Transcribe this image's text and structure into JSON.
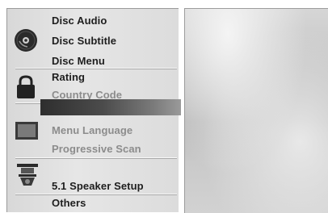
{
  "menu": {
    "items": [
      {
        "label": "Disc Audio",
        "state": "normal"
      },
      {
        "label": "Disc Subtitle",
        "state": "normal"
      },
      {
        "label": "Disc Menu",
        "state": "normal"
      },
      {
        "label": "Rating",
        "state": "normal"
      },
      {
        "label": "Country Code",
        "state": "dimmed"
      },
      {
        "label": "Menu Language",
        "state": "dimmed"
      },
      {
        "label": "Progressive Scan",
        "state": "dimmed"
      },
      {
        "label": "5.1 Speaker Setup",
        "state": "normal"
      },
      {
        "label": "Others",
        "state": "normal"
      }
    ],
    "icons": [
      "disc-icon",
      "padlock-icon",
      "tv-screen-icon",
      "speaker-icon"
    ]
  },
  "colors": {
    "background": "#ffffff",
    "panel": "#e0e0e0",
    "text_normal": "#1e1e1e",
    "text_dimmed": "#8c8c8c",
    "selected_bar": "#3a3a3a"
  }
}
